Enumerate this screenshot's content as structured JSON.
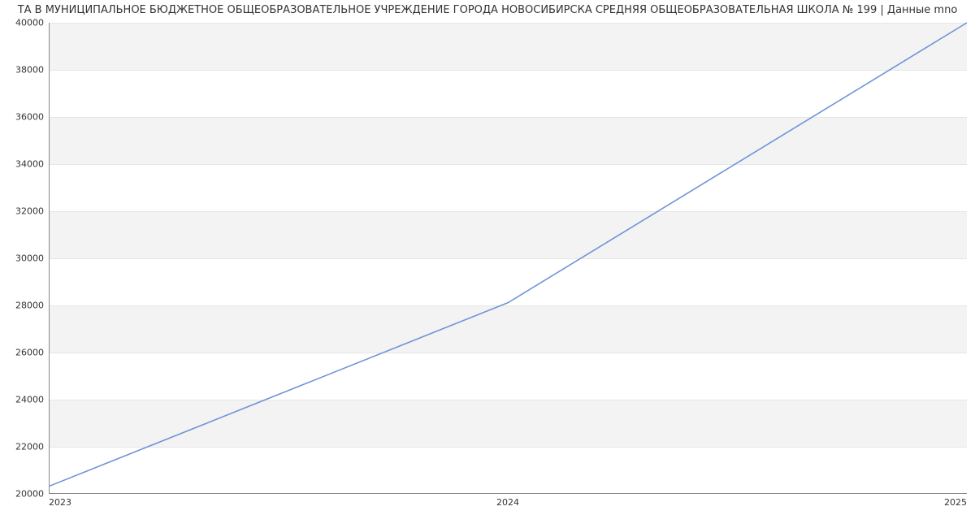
{
  "chart_data": {
    "type": "line",
    "title": "ТА В МУНИЦИПАЛЬНОЕ БЮДЖЕТНОЕ ОБЩЕОБРАЗОВАТЕЛЬНОЕ УЧРЕЖДЕНИЕ ГОРОДА НОВОСИБИРСКА СРЕДНЯЯ ОБЩЕОБРАЗОВАТЕЛЬНАЯ ШКОЛА № 199 | Данные mno",
    "x": [
      2023,
      2024,
      2025
    ],
    "values": [
      20300,
      28100,
      40000
    ],
    "xticks": [
      2023,
      2024,
      2025
    ],
    "yticks": [
      20000,
      22000,
      24000,
      26000,
      28000,
      30000,
      32000,
      34000,
      36000,
      38000,
      40000
    ],
    "xlim": [
      2023,
      2025
    ],
    "ylim": [
      20000,
      40000
    ],
    "line_color": "#6f94d8",
    "band_color": "#f3f3f3",
    "xlabel": "",
    "ylabel": ""
  }
}
